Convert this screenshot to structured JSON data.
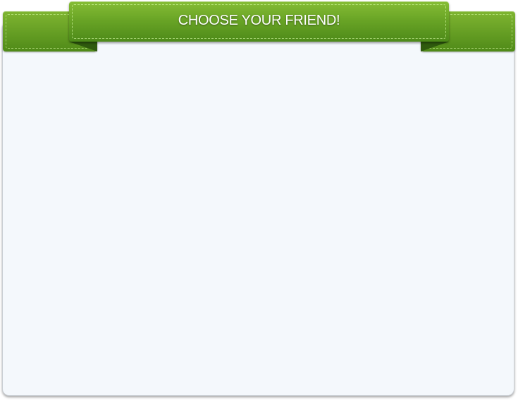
{
  "dialog": {
    "title": "CHOOSE YOUR FRIEND!",
    "colors": {
      "ribbon_green": "#6aa526",
      "ribbon_dark": "#2f5a0e",
      "panel_background": "#f4f8fc",
      "title_text": "#ffffff"
    }
  }
}
